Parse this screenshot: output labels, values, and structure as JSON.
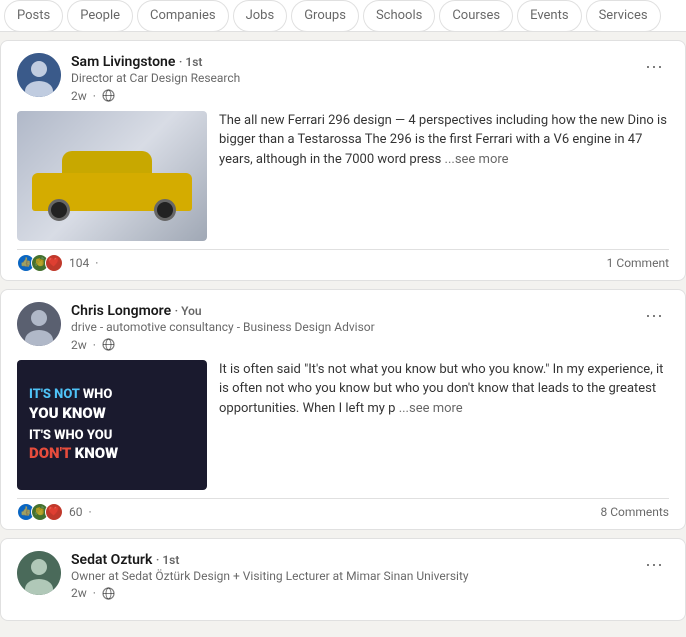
{
  "nav": {
    "tabs": [
      {
        "id": "posts",
        "label": "Posts",
        "active": false
      },
      {
        "id": "people",
        "label": "People",
        "active": false
      },
      {
        "id": "companies",
        "label": "Companies",
        "active": false
      },
      {
        "id": "jobs",
        "label": "Jobs",
        "active": false
      },
      {
        "id": "groups",
        "label": "Groups",
        "active": false
      },
      {
        "id": "schools",
        "label": "Schools",
        "active": false
      },
      {
        "id": "courses",
        "label": "Courses",
        "active": false
      },
      {
        "id": "events",
        "label": "Events",
        "active": false
      },
      {
        "id": "services",
        "label": "Services",
        "active": false
      }
    ]
  },
  "posts": [
    {
      "id": "post1",
      "author": {
        "name": "Sam Livingstone",
        "degree": "1st",
        "title": "Director at Car Design Research",
        "time": "2w",
        "globe": true
      },
      "text": "The all new Ferrari 296 design — 4 perspectives including how the new Dino is bigger than a Testarossa The 296 is the first Ferrari with a V6 engine in 47 years, although in the 7000 word press",
      "has_image": true,
      "image_type": "ferrari",
      "see_more": "...see more",
      "reactions": {
        "icons": [
          "like",
          "celebrate",
          "heart"
        ],
        "count": "104",
        "comments": "1 Comment"
      }
    },
    {
      "id": "post2",
      "author": {
        "name": "Chris Longmore",
        "degree": "You",
        "title": "drive - automotive consultancy - Business Design Advisor",
        "time": "2w",
        "globe": true
      },
      "text": "It is often said \"It's not what you know but who you know.\" In my experience, it is often not who you know but who you don't know that leads to the greatest opportunities. When I left my p",
      "has_image": true,
      "image_type": "dark-text",
      "see_more": "...see more",
      "reactions": {
        "icons": [
          "like",
          "celebrate",
          "heart"
        ],
        "count": "60",
        "comments": "8 Comments"
      }
    },
    {
      "id": "post3",
      "author": {
        "name": "Sedat Ozturk",
        "degree": "1st",
        "title": "Owner at Sedat Öztürk Design + Visiting Lecturer at Mimar Sinan University",
        "time": "2w",
        "globe": true
      },
      "text": "",
      "has_image": false,
      "image_type": "none",
      "see_more": "",
      "reactions": null
    }
  ],
  "labels": {
    "see_more": "...see more",
    "more_options": "···"
  }
}
